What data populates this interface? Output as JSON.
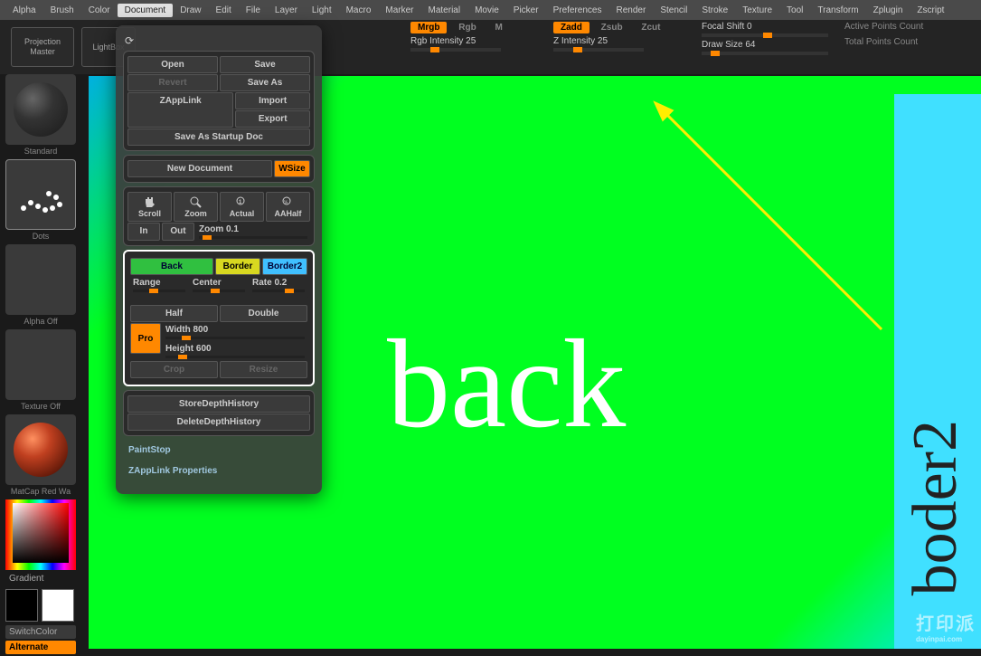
{
  "menubar": [
    "Alpha",
    "Brush",
    "Color",
    "Document",
    "Draw",
    "Edit",
    "File",
    "Layer",
    "Light",
    "Macro",
    "Marker",
    "Material",
    "Movie",
    "Picker",
    "Preferences",
    "Render",
    "Stencil",
    "Stroke",
    "Texture",
    "Tool",
    "Transform",
    "Zplugin",
    "Zscript"
  ],
  "menubar_active": "Document",
  "header": {
    "projection_master": "Projection\nMaster",
    "lightbox": "LightBox",
    "mrgb": {
      "mrgb": "Mrgb",
      "rgb": "Rgb",
      "m": "M"
    },
    "zmode": {
      "zadd": "Zadd",
      "zsub": "Zsub",
      "zcut": "Zcut"
    },
    "rgbint": {
      "label": "Rgb Intensity",
      "value": "25"
    },
    "zint": {
      "label": "Z Intensity",
      "value": "25"
    },
    "focal": {
      "label": "Focal Shift",
      "value": "0"
    },
    "drawsize": {
      "label": "Draw Size",
      "value": "64"
    },
    "active_pts": "Active Points Count",
    "total_pts": "Total Points Count"
  },
  "left": {
    "standard": "Standard",
    "dots": "Dots",
    "alpha_off": "Alpha Off",
    "texture_off": "Texture Off",
    "matcap": "MatCap Red Wa",
    "gradient": "Gradient",
    "switch": "SwitchColor",
    "alternate": "Alternate"
  },
  "doc": {
    "open": "Open",
    "save": "Save",
    "revert": "Revert",
    "saveas": "Save As",
    "zapplink": "ZAppLink",
    "import": "Import",
    "export": "Export",
    "saveasstartup": "Save As Startup Doc",
    "newdoc": "New Document",
    "wsize": "WSize",
    "scroll": "Scroll",
    "zoom": "Zoom",
    "actual": "Actual",
    "aahalf": "AAHalf",
    "in": "In",
    "out": "Out",
    "zoomval": {
      "label": "Zoom",
      "value": "0.1"
    },
    "back": "Back",
    "border": "Border",
    "border2": "Border2",
    "range": "Range",
    "center": "Center",
    "rate": {
      "label": "Rate",
      "value": "0.2"
    },
    "half": "Half",
    "double": "Double",
    "pro": "Pro",
    "width": {
      "label": "Width",
      "value": "800"
    },
    "height": {
      "label": "Height",
      "value": "600"
    },
    "crop": "Crop",
    "resize": "Resize",
    "storedepth": "StoreDepthHistory",
    "deletedepth": "DeleteDepthHistory",
    "paintstop": "PaintStop",
    "zapplinkprops": "ZAppLink Properties"
  },
  "canvas": {
    "bigtext": "back",
    "sidetext": "boder2"
  },
  "watermark": {
    "main": "打印派",
    "sub": "dayinpai.com"
  }
}
